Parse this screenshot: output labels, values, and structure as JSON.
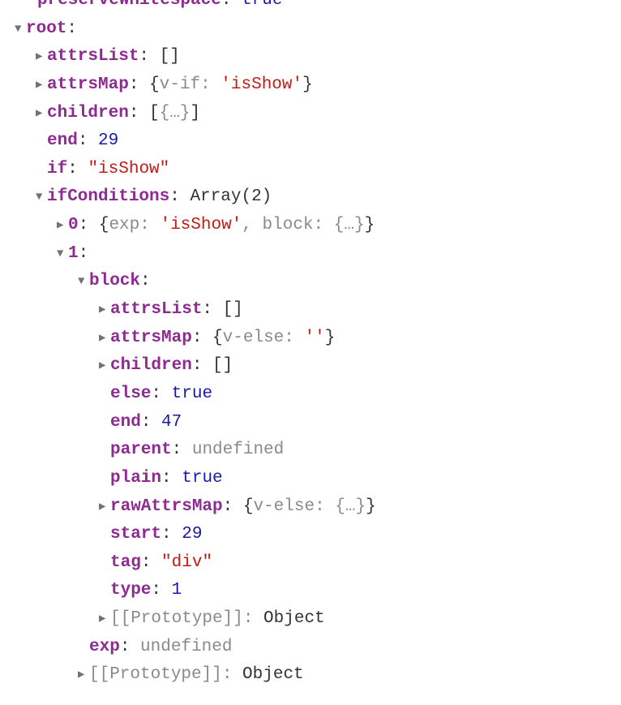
{
  "top_partial": {
    "key_fragment": "preserveWhitespace",
    "value": "true"
  },
  "root": {
    "label": "root",
    "attrsList": {
      "label": "attrsList",
      "val": "[]"
    },
    "attrsMap": {
      "label": "attrsMap",
      "open": "{",
      "k1": "v-if",
      "v1": "'isShow'",
      "close": "}"
    },
    "children": {
      "label": "children",
      "open": "[",
      "inner": "{…}",
      "close": "]"
    },
    "end": {
      "label": "end",
      "val": "29"
    },
    "if": {
      "label": "if",
      "val": "\"isShow\""
    },
    "ifConditions": {
      "label": "ifConditions",
      "summary": "Array(2)",
      "item0": {
        "idx": "0",
        "open": "{",
        "k_exp": "exp",
        "v_exp": "'isShow'",
        "k_block": "block",
        "v_block": "{…}",
        "close": "}"
      },
      "item1": {
        "idx": "1",
        "block": {
          "label": "block",
          "attrsList": {
            "label": "attrsList",
            "val": "[]"
          },
          "attrsMap": {
            "label": "attrsMap",
            "open": "{",
            "k1": "v-else",
            "v1": "''",
            "close": "}"
          },
          "children": {
            "label": "children",
            "val": "[]"
          },
          "else": {
            "label": "else",
            "val": "true"
          },
          "end": {
            "label": "end",
            "val": "47"
          },
          "parent": {
            "label": "parent",
            "val": "undefined"
          },
          "plain": {
            "label": "plain",
            "val": "true"
          },
          "rawAttrsMap": {
            "label": "rawAttrsMap",
            "open": "{",
            "k1": "v-else",
            "v1": "{…}",
            "close": "}"
          },
          "start": {
            "label": "start",
            "val": "29"
          },
          "tag": {
            "label": "tag",
            "val": "\"div\""
          },
          "type": {
            "label": "type",
            "val": "1"
          },
          "proto": {
            "label": "[[Prototype]]",
            "val": "Object"
          }
        },
        "exp": {
          "label": "exp",
          "val": "undefined"
        },
        "proto": {
          "label": "[[Prototype]]",
          "val": "Object"
        }
      }
    }
  }
}
